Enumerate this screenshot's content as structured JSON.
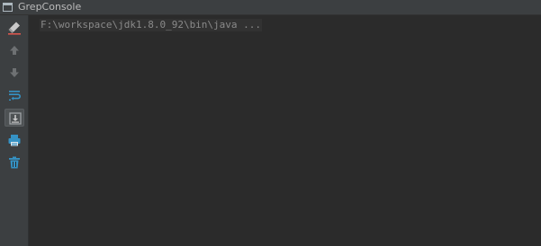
{
  "window": {
    "title": "GrepConsole"
  },
  "toolbar": {
    "buttons": [
      {
        "icon": "clear-highlight-icon"
      },
      {
        "icon": "arrow-up-icon"
      },
      {
        "icon": "arrow-down-icon"
      },
      {
        "icon": "soft-wrap-icon"
      },
      {
        "icon": "scroll-to-end-icon",
        "selected": true
      },
      {
        "icon": "print-icon"
      },
      {
        "icon": "trash-icon"
      }
    ]
  },
  "console": {
    "lines": [
      "F:\\workspace\\jdk1.8.0_92\\bin\\java ..."
    ]
  },
  "colors": {
    "background": "#2b2b2b",
    "panel": "#3c3f41",
    "icon_blue": "#3592c4",
    "icon_gray": "#6e7173"
  }
}
